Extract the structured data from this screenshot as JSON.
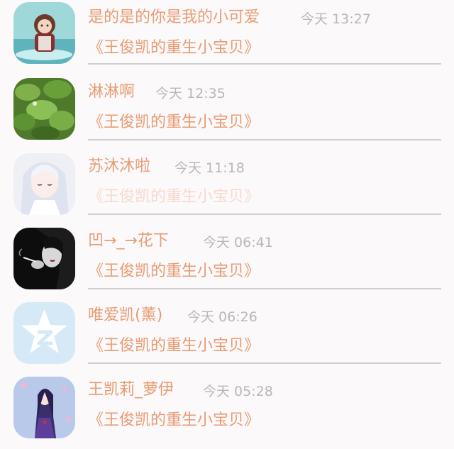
{
  "conversations": [
    {
      "name": "是的是的你是我的小可爱",
      "time": "今天 13:27",
      "title": "《王俊凯的重生小宝贝》",
      "avatar_icon": "anime-girl-avatar-icon"
    },
    {
      "name": "淋淋啊",
      "time": "今天 12:35",
      "title": "《王俊凯的重生小宝贝》",
      "avatar_icon": "leaves-photo-avatar-icon"
    },
    {
      "name": "苏沐沐啦",
      "time": "今天 11:18",
      "title": "《王俊凯的重生小宝贝》",
      "avatar_icon": "white-hair-girl-avatar-icon",
      "title_faded": true
    },
    {
      "name": "凹→_→花下",
      "time": "今天 06:41",
      "title": "《王俊凯的重生小宝贝》",
      "avatar_icon": "smoking-woman-avatar-icon"
    },
    {
      "name": "唯爱凯(薰)",
      "time": "今天 06:26",
      "title": "《王俊凯的重生小宝贝》",
      "avatar_icon": "default-star-avatar-icon"
    },
    {
      "name": "王凯莉_萝伊",
      "time": "今天 05:28",
      "title": "《王俊凯的重生小宝贝》",
      "avatar_icon": "purple-anime-girl-avatar-icon"
    }
  ],
  "colors": {
    "name": "#e89c74",
    "time": "#b8b8b8",
    "title": "#e89c74",
    "title_faded": "#f7d9cf",
    "divider": "#cfcfcf",
    "background": "#fbf9fa"
  }
}
